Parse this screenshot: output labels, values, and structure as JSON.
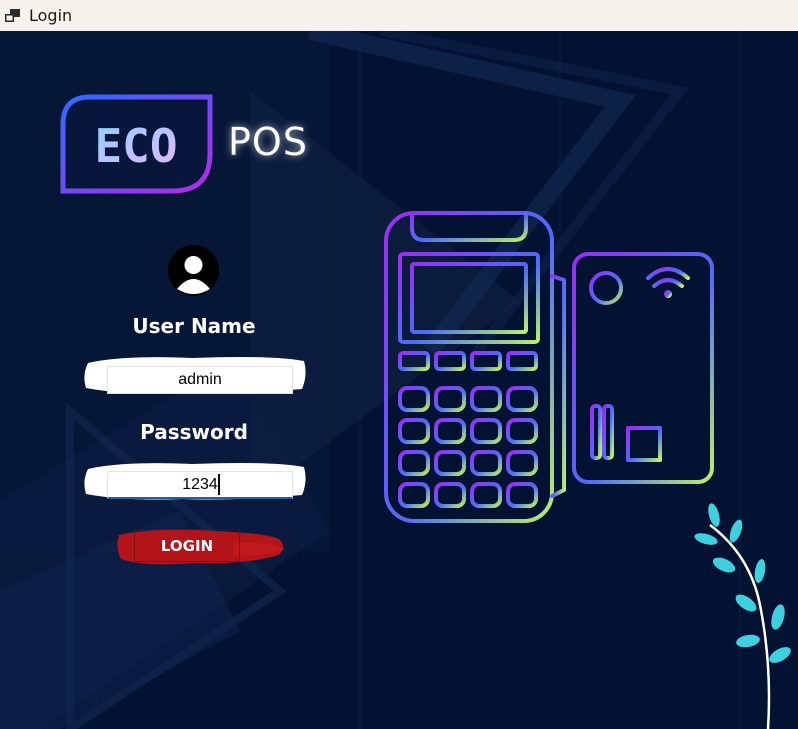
{
  "window": {
    "title": "Login",
    "icon": "app-window-icon"
  },
  "logo": {
    "badge_text": "ECO",
    "suffix_text": "POS"
  },
  "form": {
    "avatar_icon": "user-avatar-icon",
    "username_label": "User Name",
    "username_value": "admin",
    "password_label": "Password",
    "password_value": "1234",
    "login_label": "LOGIN"
  },
  "illustration": {
    "device_icon": "pos-terminal-icon",
    "plant_icon": "plant-leaves-icon"
  },
  "colors": {
    "background": "#031232",
    "login_red": "#b3141a",
    "leaf_cyan": "#3fd0e0",
    "gradient_start": "#9b2cf5",
    "gradient_end": "#b8f26a"
  }
}
